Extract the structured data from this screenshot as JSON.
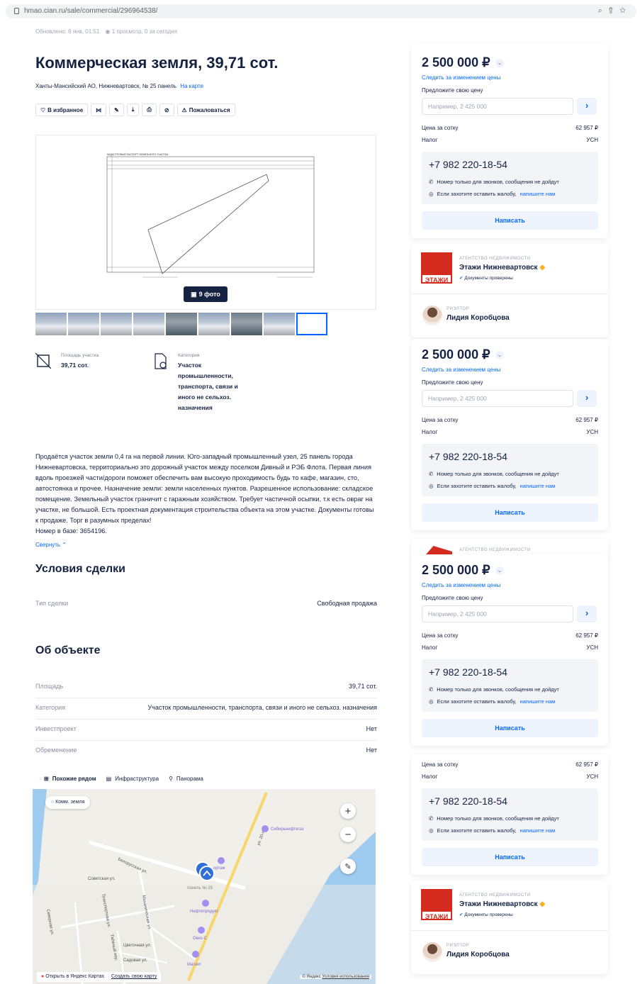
{
  "browser": {
    "url": "hmao.cian.ru/sale/commercial/296964538/"
  },
  "meta": {
    "updated": "Обновлено: 6 янв, 01:51",
    "views": "1 просмотр, 0 за сегодня"
  },
  "listing": {
    "title": "Коммерческая земля, 39,71 сот.",
    "address": "Ханты-Мансийский АО, Нижневартовск, № 25 панель",
    "map_link": "На карте"
  },
  "toolbar": {
    "favorite": "В избранное",
    "complain": "Пожаловаться"
  },
  "gallery": {
    "photo_count": "9 фото",
    "map_doc_title": "КАДАСТРОВЫЙ ПАСПОРТ ЗЕМЕЛЬНОГО УЧАСТКА"
  },
  "features": [
    {
      "label": "Площадь участка",
      "value": "39,71 сот."
    },
    {
      "label": "Категория",
      "value": "Участок промышленности, транспорта, связи и иного не сельхоз. назначения"
    }
  ],
  "description": {
    "text": "Продаётся участок земли 0,4 га на первой линии. Юго-западный промышленный узел, 25 панель города Нижневартовска, территориально это дорожный участок между поселком Дивный и РЭБ Флота. Первая линия вдоль проезжей части/дороги поможет обеспечить вам высокую проходимость будь то кафе, магазин, сто, автостоянка и прочее. Назначение земли: земли населенных пунктов. Разрешенное использование: складское помещение. Земельный участок граничит с гаражным хозяйством. Требует частичной осыпки, т.к есть овраг на участке, не большой. Есть проектная документация строительства объекта на этом участке. Документы готовы к продаже. Торг в разумных пределах!",
    "base_number": "Номер в базе: 3654196.",
    "collapse": "Свернуть"
  },
  "deal": {
    "heading": "Условия сделки",
    "rows": [
      {
        "k": "Тип сделки",
        "v": "Свободная продажа"
      }
    ]
  },
  "object": {
    "heading": "Об объекте",
    "rows": [
      {
        "k": "Площадь",
        "v": "39,71 сот."
      },
      {
        "k": "Категория",
        "v": "Участок промышленности, транспорта, связи и иного не сельхоз. назначения"
      },
      {
        "k": "Инвестпроект",
        "v": "Нет"
      },
      {
        "k": "Обременение",
        "v": "Нет"
      }
    ]
  },
  "map": {
    "tabs": [
      "Похожие рядом",
      "Инфраструктура",
      "Панорама"
    ],
    "chip": "Комм. земля",
    "labels": {
      "street1": "Белорусская ул.",
      "street2": "Советская ул.",
      "street3": "ул. 20-я",
      "street4": "Северная ул.",
      "street5": "Транспортная ул.",
      "street6": "Механическая ул.",
      "street7": "Цветочная ул.",
      "street8": "Садовая ул.",
      "street9": "Таёжный пер.",
      "poi1": "Сибирьнефтегаз",
      "poi2": "Нефтепродукт",
      "poi3": "Окис-С",
      "poi4": "Магнит",
      "poi5": "панель № 25",
      "poi6": "ортаж"
    },
    "open": "Открыть в Яндекс Картах",
    "create": "Создать свою карту",
    "copyright": "© Яндекс",
    "terms": "Условия использования"
  },
  "price_card": {
    "price": "2 500 000 ₽",
    "follow": "Следить за изменением цены",
    "offer_label": "Предложите свою цену",
    "offer_placeholder": "Например, 2 425 000",
    "per_sotka_label": "Цена за сотку",
    "per_sotka": "62 957 ₽",
    "tax_label": "Налог",
    "tax": "УСН",
    "phone": "+7 982 220-18-54",
    "calls_only": "Номер только для звонков, сообщения не дойдут",
    "complaint_text": "Если захотите оставить жалобу,",
    "complaint_link": "напишите нам",
    "write": "Написать"
  },
  "agency": {
    "type": "АГЕНТСТВО НЕДВИЖИМОСТИ",
    "name": "Этажи Нижневартовск",
    "verified": "Документы проверены",
    "logo_text": "ЭТАЖИ",
    "realtor_type": "РИЭЛТОР",
    "realtor": "Лидия Коробцова"
  },
  "colors": {
    "accent": "#0468ff",
    "text": "#152242",
    "brand": "#d52b1e"
  }
}
